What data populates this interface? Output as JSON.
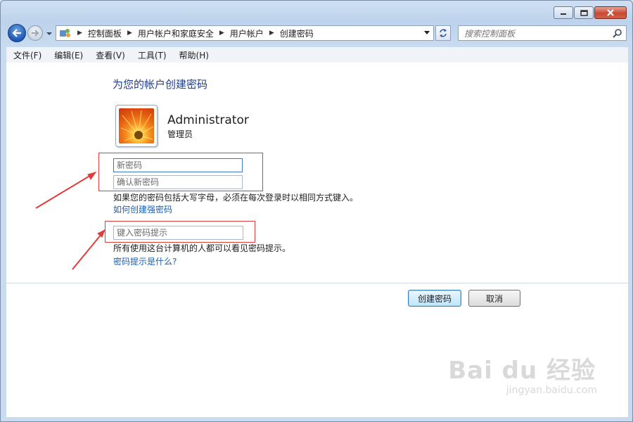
{
  "window": {
    "minimize_icon": "minimize-icon",
    "maximize_icon": "maximize-icon",
    "close_icon": "close-icon"
  },
  "address_bar": {
    "breadcrumbs": [
      "控制面板",
      "用户帐户和家庭安全",
      "用户帐户",
      "创建密码"
    ]
  },
  "search": {
    "placeholder": "搜索控制面板"
  },
  "menu": [
    "文件(F)",
    "编辑(E)",
    "查看(V)",
    "工具(T)",
    "帮助(H)"
  ],
  "page": {
    "title": "为您的帐户创建密码",
    "user_name": "Administrator",
    "user_role": "管理员",
    "new_password_placeholder": "新密码",
    "confirm_password_placeholder": "确认新密码",
    "case_note": "如果您的密码包括大写字母，必须在每次登录时以相同方式键入。",
    "strong_password_link": "如何创建强密码",
    "hint_placeholder": "键入密码提示",
    "hint_note": "所有使用这台计算机的人都可以看见密码提示。",
    "hint_link": "密码提示是什么?"
  },
  "buttons": {
    "create": "创建密码",
    "cancel": "取消"
  },
  "watermark": {
    "main": "Bai du 经验",
    "sub": "jingyan.baidu.com"
  },
  "colors": {
    "accent": "#1f3d8a",
    "link": "#1a5fb4",
    "annotation": "#e33b3b"
  }
}
